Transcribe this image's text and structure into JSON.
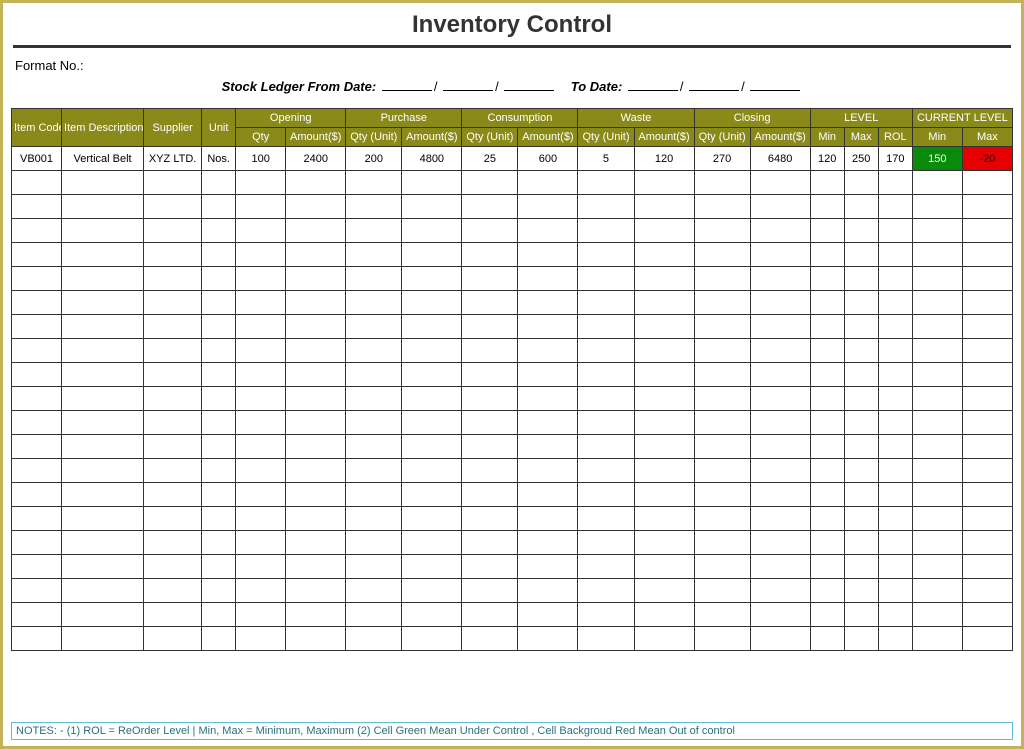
{
  "title": "Inventory Control",
  "format_label": "Format No.:",
  "ledger": {
    "from_label": "Stock Ledger From Date:",
    "to_label": "To Date:"
  },
  "headers": {
    "item_code": "Item Code",
    "item_desc": "Item Description",
    "supplier": "Supplier",
    "unit": "Unit",
    "opening": "Opening",
    "purchase": "Purchase",
    "consumption": "Consumption",
    "waste": "Waste",
    "closing": "Closing",
    "level": "LEVEL",
    "current_level": "CURRENT LEVEL",
    "qty": "Qty",
    "amount": "Amount($)",
    "qty_unit": "Qty (Unit)",
    "min": "Min",
    "max": "Max",
    "rol": "ROL"
  },
  "rows": [
    {
      "item_code": "VB001",
      "item_desc": "Vertical Belt",
      "supplier": "XYZ LTD.",
      "unit": "Nos.",
      "opening_qty": "100",
      "opening_amt": "2400",
      "purchase_qty": "200",
      "purchase_amt": "4800",
      "consumption_qty": "25",
      "consumption_amt": "600",
      "waste_qty": "5",
      "waste_amt": "120",
      "closing_qty": "270",
      "closing_amt": "6480",
      "level_min": "120",
      "level_max": "250",
      "level_rol": "170",
      "current_min": "150",
      "current_max": "-20",
      "current_min_status": "green",
      "current_max_status": "red"
    }
  ],
  "empty_rows": 20,
  "notes": "NOTES: - (1) ROL = ReOrder Level | Min, Max = Minimum, Maximum     (2) Cell Green Mean Under Control , Cell Backgroud Red Mean Out of control"
}
